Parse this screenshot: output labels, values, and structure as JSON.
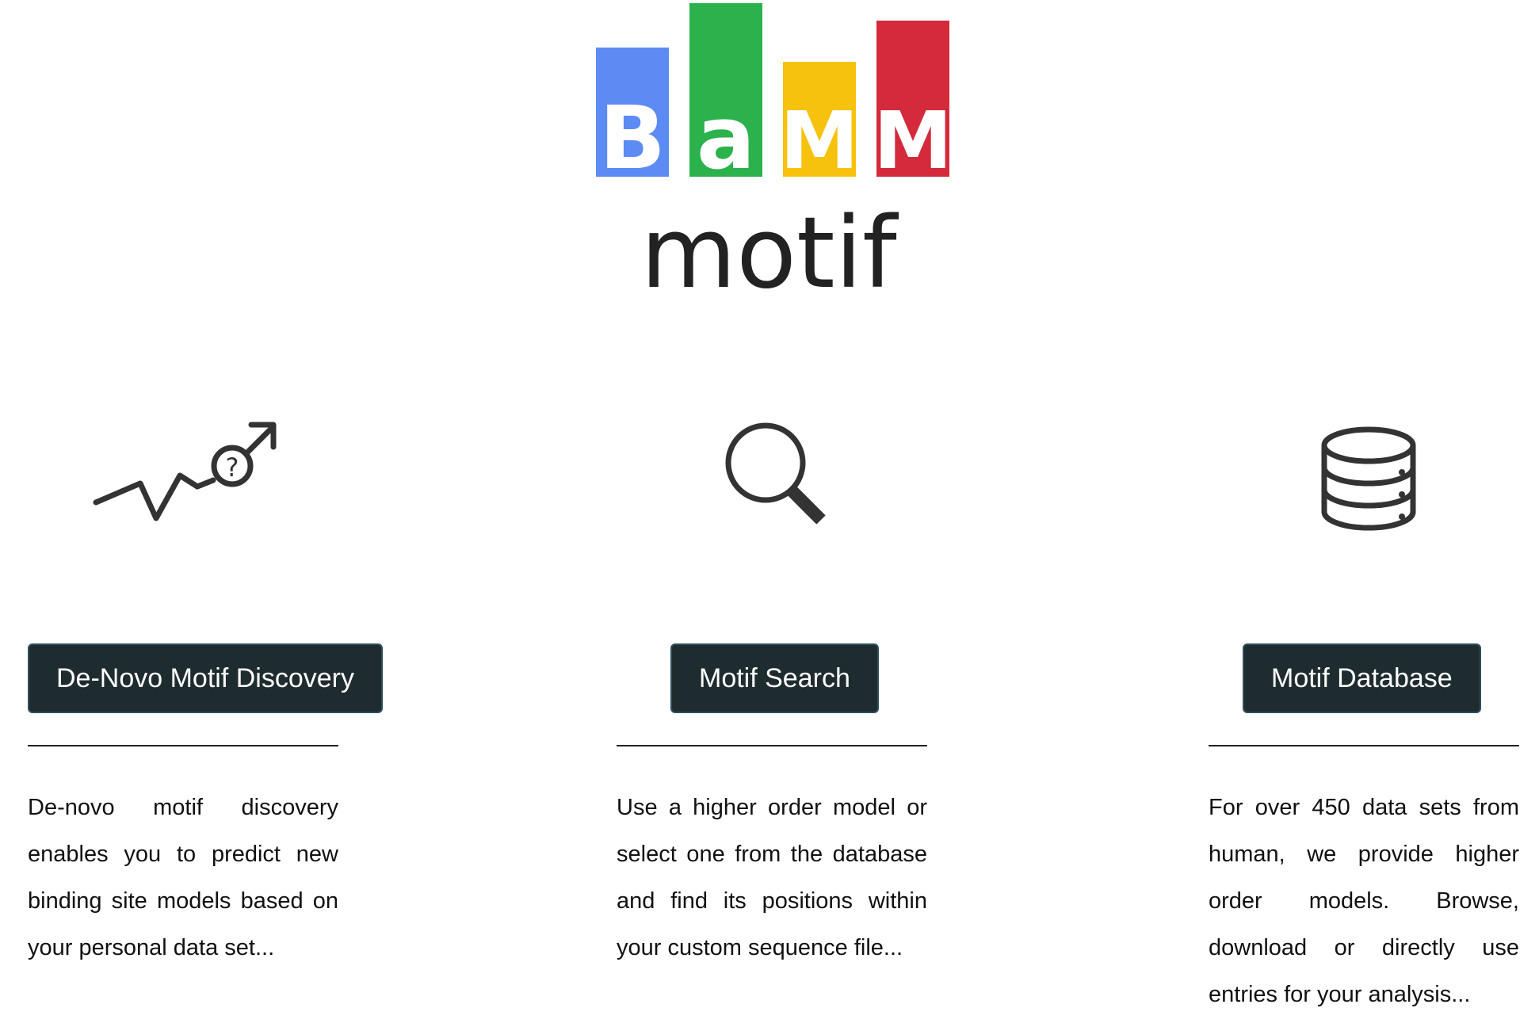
{
  "logo": {
    "letters": [
      "B",
      "a",
      "M",
      "M"
    ],
    "wordmark": "motif",
    "colors": {
      "blue": "#5b8bf3",
      "green": "#2bb24c",
      "yellow": "#f7c20e",
      "red": "#d42a3c"
    }
  },
  "features": [
    {
      "icon": "trend-question-arrow-icon",
      "button_label": "De-Novo Motif Discovery",
      "description": "De-novo motif discovery enables you to predict new binding site models based on your personal data set..."
    },
    {
      "icon": "magnifier-icon",
      "button_label": "Motif Search",
      "description": "Use a higher order model or select one from the database and find its positions within your custom sequence file..."
    },
    {
      "icon": "database-icon",
      "button_label": "Motif Database",
      "description": "For over 450 data sets from human, we provide higher order models. Browse, download or directly use entries for your analysis..."
    }
  ],
  "colors": {
    "button_bg": "#1f2c2f",
    "button_text": "#ffffff",
    "text": "#111111"
  }
}
